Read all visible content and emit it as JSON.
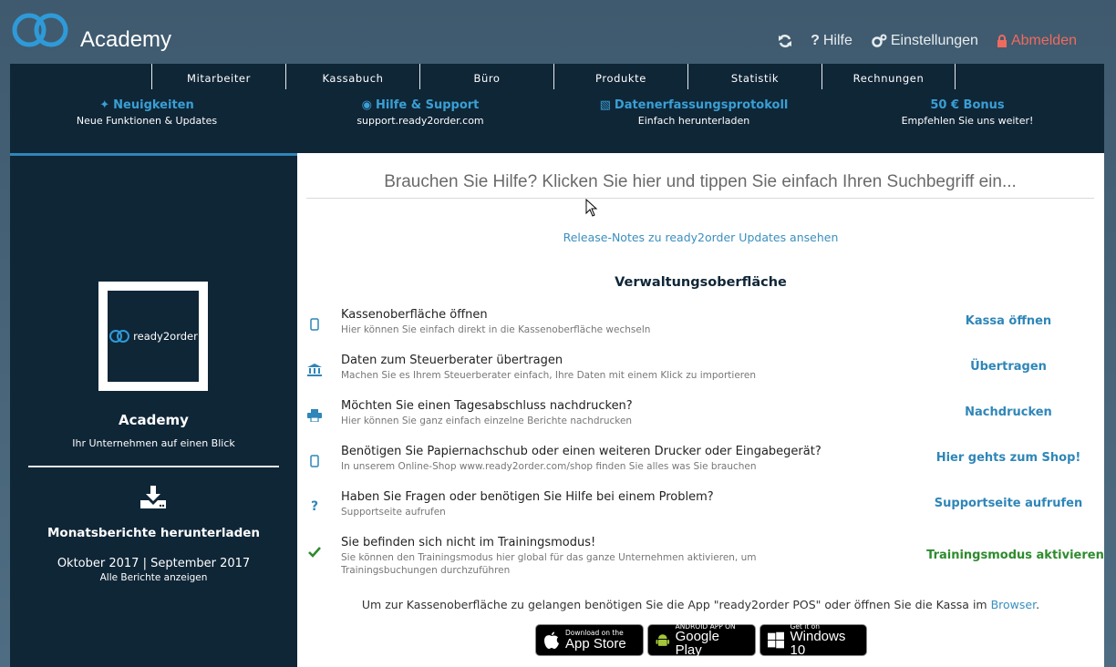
{
  "header": {
    "app_title": "Academy",
    "help_label": "Hilfe",
    "settings_label": "Einstellungen",
    "logout_label": "Abmelden"
  },
  "nav": {
    "tabs": [
      "Mitarbeiter",
      "Kassabuch",
      "Büro",
      "Produkte",
      "Statistik",
      "Rechnungen"
    ]
  },
  "promos": [
    {
      "title": "Neuigkeiten",
      "subtitle": "Neue Funktionen & Updates"
    },
    {
      "title": "Hilfe & Support",
      "subtitle": "support.ready2order.com"
    },
    {
      "title": "Datenerfassungsprotokoll",
      "subtitle": "Einfach herunterladen"
    },
    {
      "title": "50 € Bonus",
      "subtitle": "Empfehlen Sie uns weiter!"
    }
  ],
  "sidebar": {
    "brand_text": "ready2order",
    "company_name": "Academy",
    "company_sub": "Ihr Unternehmen auf einen Blick",
    "reports_title": "Monatsberichte herunterladen",
    "months": "Oktober 2017 | September 2017",
    "all_reports": "Alle Berichte anzeigen"
  },
  "main": {
    "search_placeholder": "Brauchen Sie Hilfe? Klicken Sie hier und tippen Sie einfach Ihren Suchbegriff ein...",
    "release_link": "Release-Notes zu ready2order Updates ansehen",
    "section_title": "Verwaltungsoberfläche",
    "rows": [
      {
        "icon": "tablet-icon",
        "title": "Kassenoberfläche öffnen",
        "desc": "Hier können Sie einfach direkt in die Kassenoberfläche wechseln",
        "action": "Kassa öffnen"
      },
      {
        "icon": "bank-icon",
        "title": "Daten zum Steuerberater übertragen",
        "desc": "Machen Sie es Ihrem Steuerberater einfach, Ihre Daten mit einem Klick zu importieren",
        "action": "Übertragen"
      },
      {
        "icon": "printer-icon",
        "title": "Möchten Sie einen Tagesabschluss nachdrucken?",
        "desc": "Hier können Sie ganz einfach einzelne Berichte nachdrucken",
        "action": "Nachdrucken"
      },
      {
        "icon": "tablet-icon",
        "title": "Benötigen Sie Papiernachschub oder einen weiteren Drucker oder Eingabegerät?",
        "desc": "In unserem Online-Shop www.ready2order.com/shop finden Sie alles was Sie brauchen",
        "action": "Hier gehts zum Shop!"
      },
      {
        "icon": "question-icon",
        "title": "Haben Sie Fragen oder benötigen Sie Hilfe bei einem Problem?",
        "desc": "Supportseite aufrufen",
        "action": "Supportseite aufrufen"
      },
      {
        "icon": "check-icon",
        "title": "Sie befinden sich nicht im Trainingsmodus!",
        "desc": "Sie können den Trainingsmodus hier global für das ganze Unternehmen aktivieren, um Trainingsbuchungen durchzuführen",
        "action": "Trainingsmodus aktivieren"
      }
    ],
    "bottom_note": "Um zur Kassenoberfläche zu gelangen benötigen Sie die App \"ready2order POS\" oder öffnen Sie die Kassa im",
    "bottom_link": "Browser",
    "bottom_dot": ".",
    "badges": [
      {
        "small": "Download on the",
        "big": "App Store"
      },
      {
        "small": "ANDROID APP ON",
        "big": "Google Play"
      },
      {
        "small": "Get it on",
        "big": "Windows 10"
      }
    ]
  },
  "colors": {
    "panel": "#0f2637",
    "accent": "#2f86b8",
    "logout": "#ef6a5e",
    "success": "#2e8b2e"
  }
}
